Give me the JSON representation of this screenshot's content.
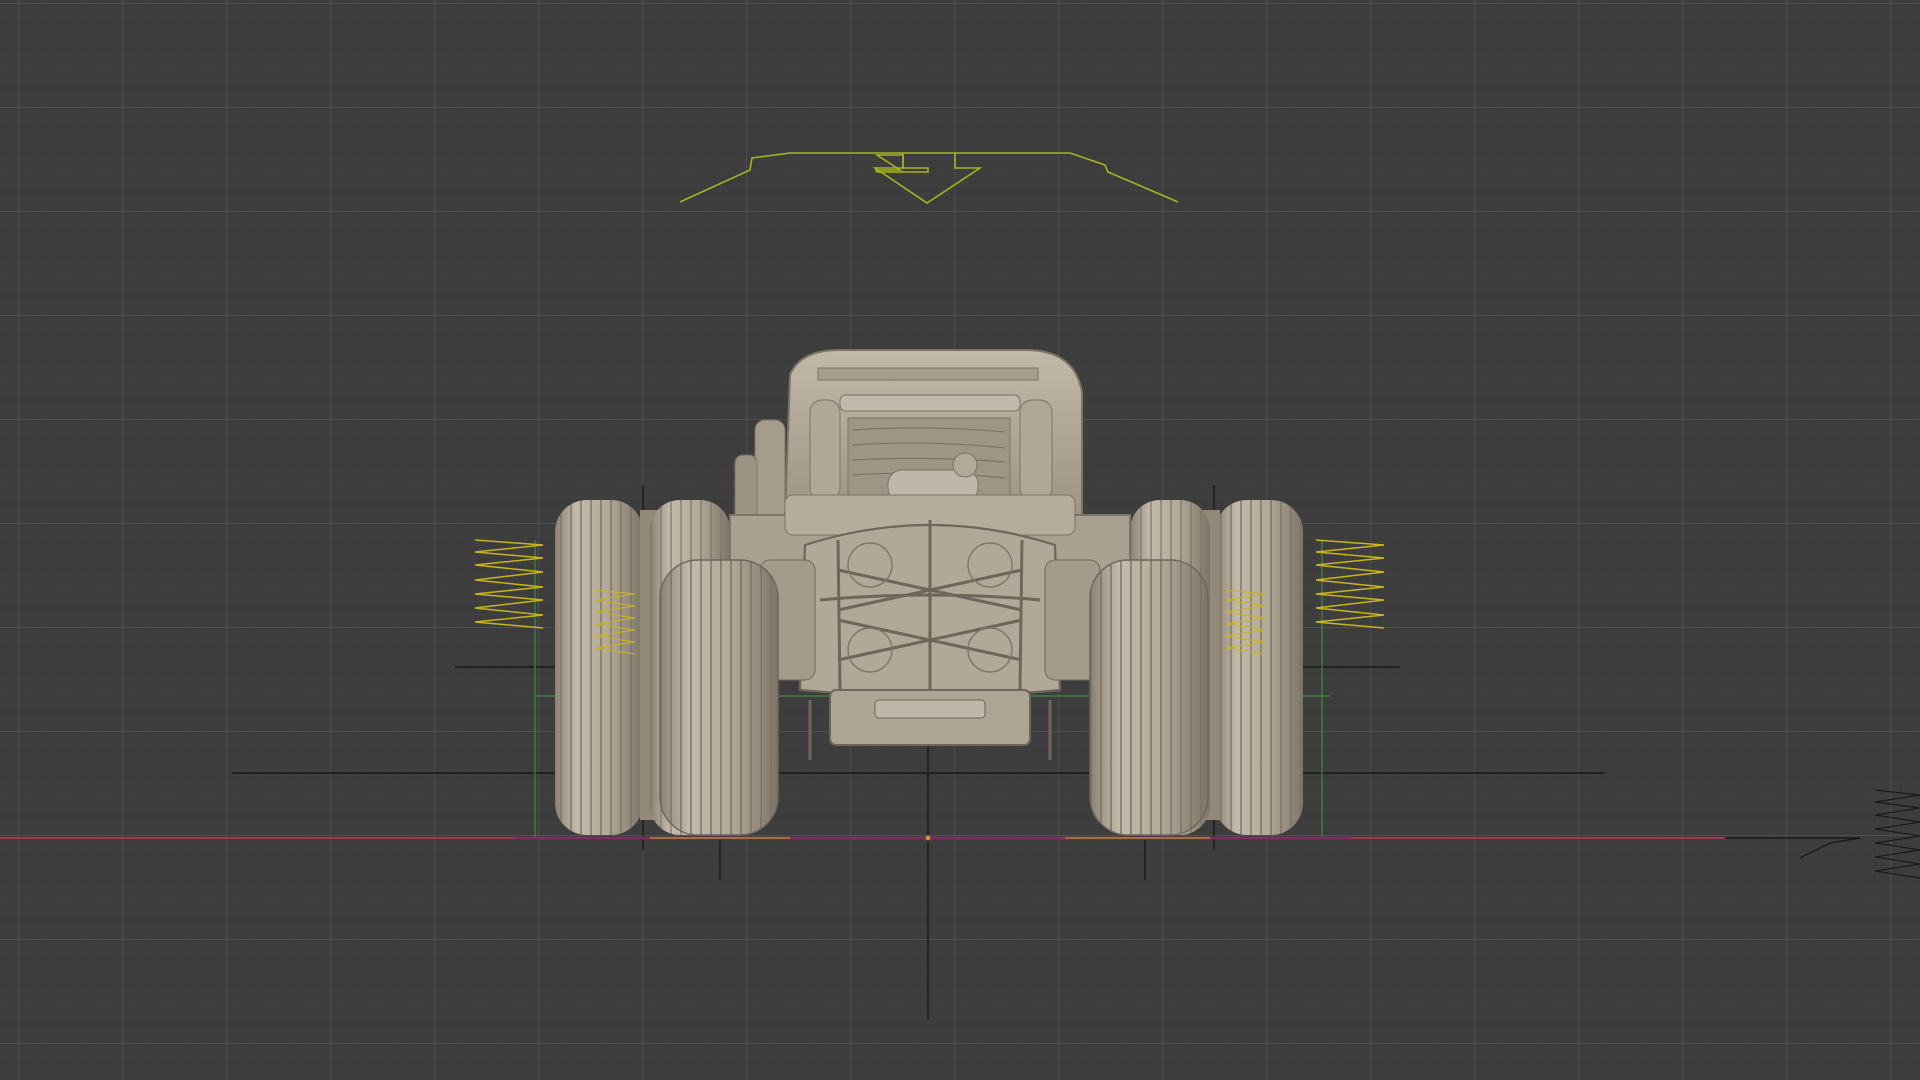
{
  "viewport": {
    "background_color": "#3d3d3d",
    "grid_minor_color": "#444444",
    "grid_major_color": "#505050"
  },
  "colors": {
    "body": "#b5ab9c",
    "body_shadow": "#8e8576",
    "body_dark": "#6e665a",
    "body_highlight": "#cdc4b5",
    "spring_yellow": "#c8b41e",
    "rig_green": "#a6b41f",
    "axis_red": "#b8364d",
    "axis_green": "#3f8a3f",
    "axis_blue": "#4a4aa8",
    "helper_black": "#1a1a1a"
  },
  "objects": {
    "vehicle": "buggy-model",
    "rig_control": "body-rig-control",
    "springs": [
      "left-outer-spring",
      "left-inner-spring",
      "right-inner-spring",
      "right-outer-spring"
    ],
    "wheels": [
      "left-rear-wheel",
      "left-front-wheel",
      "right-front-wheel",
      "right-rear-wheel"
    ]
  }
}
